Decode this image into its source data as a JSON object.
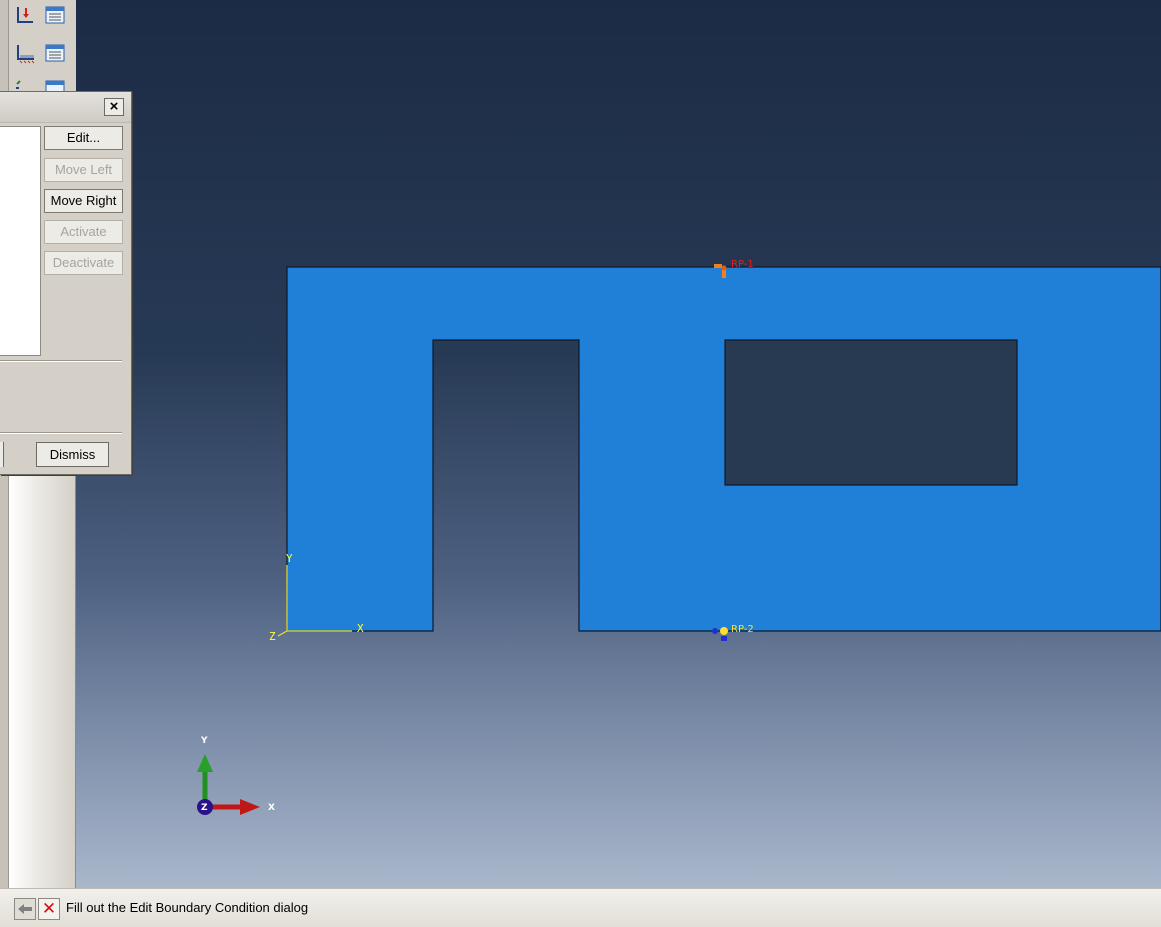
{
  "toolbar": {
    "icons": [
      "bc-create-icon",
      "bc-manager-icon",
      "load-create-icon",
      "load-manager-icon",
      "field-icon",
      "field-manager-icon"
    ]
  },
  "dialog": {
    "close_label": "×",
    "buttons": [
      {
        "label": "Edit...",
        "enabled": true
      },
      {
        "label": "Move Left",
        "enabled": false
      },
      {
        "label": "Move Right",
        "enabled": true
      },
      {
        "label": "Activate",
        "enabled": false
      },
      {
        "label": "Deactivate",
        "enabled": false
      }
    ],
    "dismiss_label": "Dismiss"
  },
  "viewport": {
    "part_color": "#2080d8",
    "background_top": "#1c2b45",
    "background_bottom": "#a9b7cb",
    "reference_points": [
      {
        "label": "RP-1",
        "color": "#e02020"
      },
      {
        "label": "RP-2",
        "color": "#ffe030"
      }
    ],
    "csys_labels": {
      "x": "X",
      "y": "Y",
      "z": "Z"
    },
    "triad_labels": {
      "x": "X",
      "y": "Y",
      "z": "Z"
    }
  },
  "status": {
    "message": "Fill out the Edit Boundary Condition dialog"
  }
}
